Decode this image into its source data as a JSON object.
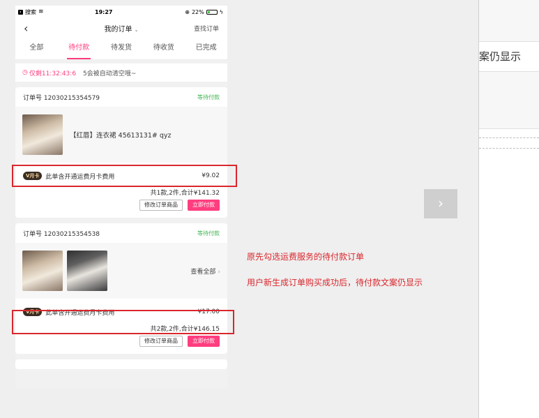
{
  "status_bar": {
    "back_app": "搜索",
    "time": "19:27",
    "battery": "22%",
    "battery_level": 0.22
  },
  "nav": {
    "back": "‹",
    "title": "我的订单",
    "title_chevron": "⌄",
    "find": "查找订单"
  },
  "tabs": [
    {
      "label": "全部",
      "active": false
    },
    {
      "label": "待付款",
      "active": true
    },
    {
      "label": "待发货",
      "active": false
    },
    {
      "label": "待收货",
      "active": false
    },
    {
      "label": "已完成",
      "active": false
    }
  ],
  "notice": {
    "timer": "仅剩11:32:43:6",
    "text": "5会被自动清空哦~"
  },
  "orders": [
    {
      "order_no": "订单号 12030215354579",
      "status": "等待付款",
      "goods_name": "【红唇】连衣裙  45613131#  qyz",
      "vip_badge": "V月卡",
      "vip_text": "此单含开通运费月卡费用",
      "vip_price": "¥9.02",
      "total": "共1款,2件,合计¥141.32",
      "btn_modify": "修改订单商品",
      "btn_pay": "立即付款"
    },
    {
      "order_no": "订单号 12030215354538",
      "status": "等待付款",
      "see_all": "查看全部",
      "vip_badge": "V月卡",
      "vip_text": "此单含开通运费月卡费用",
      "vip_price": "¥17.00",
      "total": "共2款,2件,合计¥146.15",
      "btn_modify": "修改订单商品",
      "btn_pay": "立即付款"
    }
  ],
  "annotations": {
    "line1": "原先勾选运费服务的待付款订单",
    "line2": "用户新生成订单购买成功后，待付款文案仍显示"
  },
  "next_arrow": "›",
  "right_panel": {
    "text": "案仍显示"
  },
  "colors": {
    "accent": "#ff3d7f",
    "status_green": "#3fb34f",
    "annotation_red": "#d9262c"
  }
}
